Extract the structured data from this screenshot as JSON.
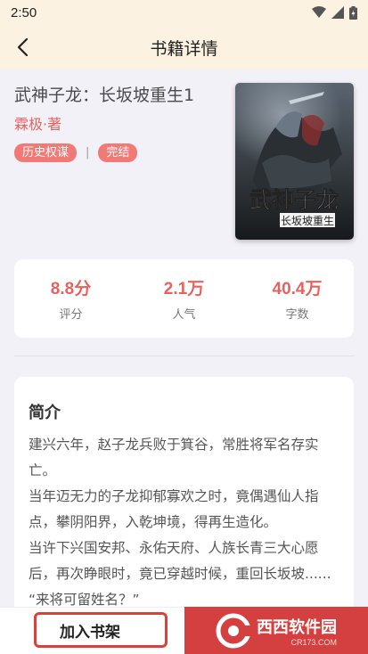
{
  "status_bar": {
    "time": "2:50"
  },
  "header": {
    "title": "书籍详情"
  },
  "book": {
    "title": "武神子龙：长坂坡重生1",
    "author": "霖极·著",
    "tags": [
      "历史权谋",
      "完结"
    ],
    "tag_separator": "|",
    "cover_title_lines": [
      "武神子龙",
      "长坂坡重生"
    ]
  },
  "stats": [
    {
      "value": "8.8分",
      "label": "评分"
    },
    {
      "value": "2.1万",
      "label": "人气"
    },
    {
      "value": "40.4万",
      "label": "字数"
    }
  ],
  "intro": {
    "heading": "简介",
    "paragraphs": [
      "建兴六年，赵子龙兵败于箕谷，常胜将军名存实亡。",
      "当年迈无力的子龙抑郁寡欢之时，竟偶遇仙人指点，攀阴阳界，入乾坤境，得再生造化。",
      "当许下兴国安邦、永佑天府、人族长青三大心愿后，再次睁眼时，竟已穿越时候，重回长坂坡......",
      "“来将可留姓名？”"
    ]
  },
  "bottom": {
    "add_shelf": "加入书架"
  },
  "watermark": {
    "text": "西西软件园",
    "sub": "CR173.COM"
  },
  "colors": {
    "accent": "#e7625f",
    "tag_bg": "#f27a76",
    "header_bg": "#fbf2e1"
  }
}
